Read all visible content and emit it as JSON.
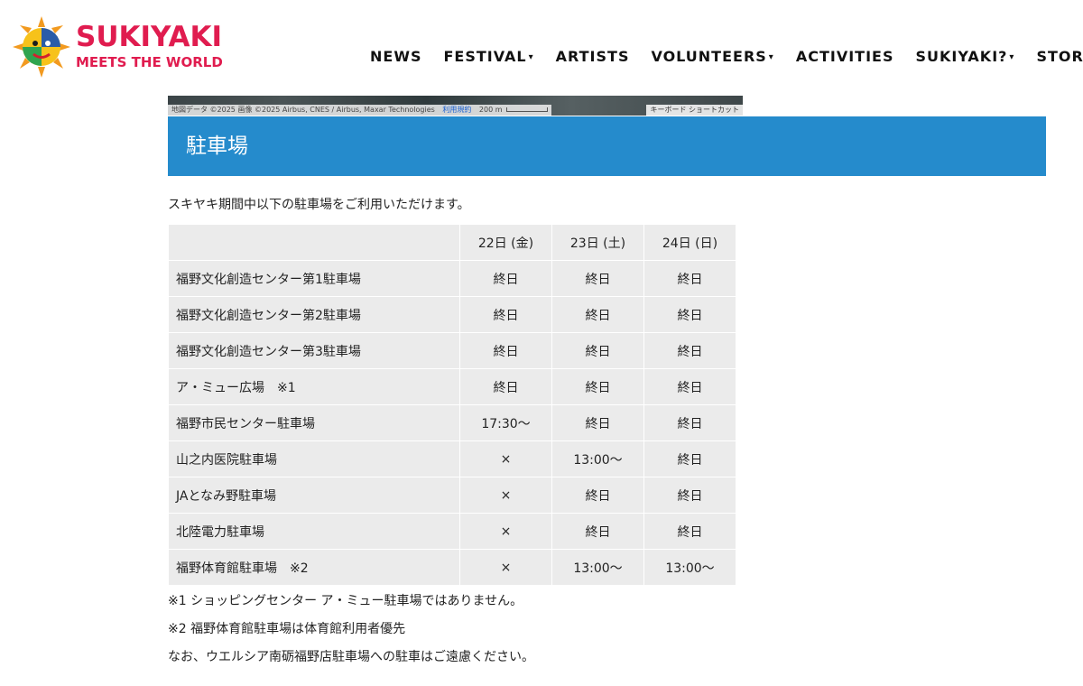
{
  "header": {
    "logo_title": "SUKIYAKI",
    "logo_subtitle": "MEETS THE WORLD",
    "nav": [
      {
        "label": "NEWS",
        "dropdown": false
      },
      {
        "label": "FESTIVAL",
        "dropdown": true
      },
      {
        "label": "ARTISTS",
        "dropdown": false
      },
      {
        "label": "VOLUNTEERS",
        "dropdown": true
      },
      {
        "label": "ACTIVITIES",
        "dropdown": false
      },
      {
        "label": "SUKIYAKI?",
        "dropdown": true
      },
      {
        "label": "STORE",
        "dropdown": false
      }
    ]
  },
  "map": {
    "attribution": "地図データ ©2025 画像 ©2025 Airbus, CNES / Airbus, Maxar Technologies",
    "terms_link": "利用規約",
    "scale": "200 m",
    "keyboard_shortcuts": "キーボード ショートカット"
  },
  "section": {
    "title": "駐車場"
  },
  "intro": "スキヤキ期間中以下の駐車場をご利用いただけます。",
  "table": {
    "headers": [
      "",
      "22日 (金)",
      "23日 (土)",
      "24日 (日)"
    ],
    "rows": [
      [
        "福野文化創造センター第1駐車場",
        "終日",
        "終日",
        "終日"
      ],
      [
        "福野文化創造センター第2駐車場",
        "終日",
        "終日",
        "終日"
      ],
      [
        "福野文化創造センター第3駐車場",
        "終日",
        "終日",
        "終日"
      ],
      [
        "ア・ミュー広場　※1",
        "終日",
        "終日",
        "終日"
      ],
      [
        "福野市民センター駐車場",
        "17:30～",
        "終日",
        "終日"
      ],
      [
        "山之内医院駐車場",
        "×",
        "13:00～",
        "終日"
      ],
      [
        "JAとなみ野駐車場",
        "×",
        "終日",
        "終日"
      ],
      [
        "北陸電力駐車場",
        "×",
        "終日",
        "終日"
      ],
      [
        "福野体育館駐車場　※2",
        "×",
        "13:00～",
        "13:00～"
      ]
    ]
  },
  "notes": [
    "※1 ショッピングセンター ア・ミュー駐車場ではありません。",
    "※2 福野体育館駐車場は体育館利用者優先",
    "なお、ウエルシア南砺福野店駐車場への駐車はご遠慮ください。"
  ],
  "colors": {
    "brand": "#e01c4f",
    "banner": "#258bcc",
    "table_bg": "#ebebeb"
  }
}
